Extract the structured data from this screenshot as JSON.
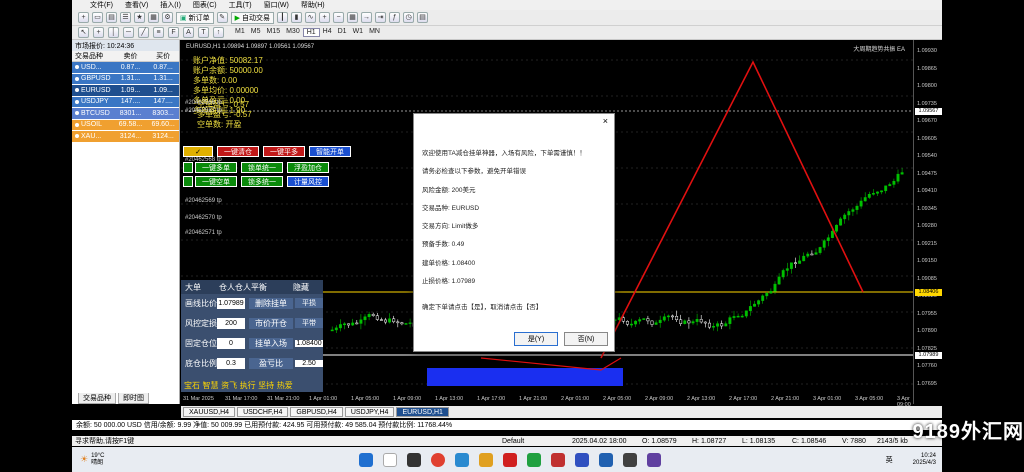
{
  "menu": [
    "文件(F)",
    "查看(V)",
    "插入(I)",
    "图表(C)",
    "工具(T)",
    "窗口(W)",
    "帮助(H)"
  ],
  "toolbar": {
    "new_order": "新订单",
    "auto_trade": "自动交易"
  },
  "timeframes": [
    "M1",
    "M5",
    "M15",
    "M30",
    "H1",
    "H4",
    "D1",
    "W1",
    "MN"
  ],
  "market_watch": {
    "title": "市场报价: 10:24:36",
    "headers": [
      "交易品种",
      "卖价",
      "买价"
    ],
    "rows": [
      {
        "symbol": "USD...",
        "bid": "0.87...",
        "ask": "0.87...",
        "color": "#3a76c4"
      },
      {
        "symbol": "GBPUSD",
        "bid": "1.31...",
        "ask": "1.31...",
        "color": "#3a76c4"
      },
      {
        "symbol": "EURUSD",
        "bid": "1.09...",
        "ask": "1.09...",
        "color": "#1f4f8f"
      },
      {
        "symbol": "USDJPY",
        "bid": "147....",
        "ask": "147....",
        "color": "#3a76c4"
      },
      {
        "symbol": "BTCUSD",
        "bid": "8301...",
        "ask": "8303...",
        "color": "#5a7fd0"
      },
      {
        "symbol": "USOIL",
        "bid": "69.58...",
        "ask": "69.60...",
        "color": "#f0a030"
      },
      {
        "symbol": "XAU...",
        "bid": "3124...",
        "ask": "3124...",
        "color": "#f0a030"
      }
    ],
    "tabs": [
      "交易品种",
      "即时图"
    ]
  },
  "chart": {
    "title": "EURUSD,H1  1.09894 1.09897 1.09561 1.09567",
    "right_title": "大周期趋势共振 EA",
    "account": [
      "账户净值: 50082.17",
      "账户余额: 50000.00",
      "多单数: 0.00",
      "多单均价: 0.00000",
      "多单盈亏: 0.00",
      "多单盈利: 1.90"
    ],
    "account_extra": [
      "空单盈亏: 0.57",
      "多单盈亏: -0.57",
      "空单数: 开盈"
    ],
    "order_ids": [
      "#20462566 tp",
      "#20462567 tp",
      "#20462568 tp",
      "#20462569 tp",
      "#20462570 tp",
      "#20462571 tp"
    ],
    "buttons_row1": [
      "一键清仓",
      "一键平多",
      "智能开单"
    ],
    "buttons_row2": [
      "一键多单",
      "锁单统一",
      "浮盈加仓"
    ],
    "buttons_row3": [
      "一键空单",
      "锁多统一",
      "计量风控"
    ],
    "panel": {
      "header_left": "大单",
      "header_mid": "仓人仓人平衡",
      "header_right": "隐藏",
      "rows": [
        {
          "label": "画线比价",
          "value": "1.07989",
          "btn": "删除挂单",
          "btn2": "平损"
        },
        {
          "label": "风控定损",
          "value": "200",
          "btn": "市价开仓",
          "btn2": "平带"
        },
        {
          "label": "固定仓位",
          "value": "0",
          "btn": "挂单入场",
          "btn2": "1.08400"
        },
        {
          "label": "底仓比例",
          "value": "0.3",
          "btn": "盈亏比",
          "btn2": "2.50"
        }
      ],
      "footer": "宝石 智慧 资飞 执行 坚持 热爱"
    }
  },
  "price_ticks": [
    "1.09930",
    "1.09865",
    "1.09800",
    "1.09735",
    "1.09670",
    "1.09605",
    "1.09540",
    "1.09475",
    "1.09410",
    "1.09345",
    "1.09280",
    "1.09215",
    "1.09150",
    "1.09085",
    "1.08020",
    "1.07955",
    "1.07890",
    "1.07825",
    "1.07760",
    "1.07695"
  ],
  "price_markers": {
    "current": "1.09567",
    "tp": "1.08406",
    "sl": "1.07989"
  },
  "time_ticks": [
    "31 Mar 2025",
    "31 Mar 17:00",
    "31 Mar 21:00",
    "1 Apr 01:00",
    "1 Apr 05:00",
    "1 Apr 09:00",
    "1 Apr 13:00",
    "1 Apr 17:00",
    "1 Apr 21:00",
    "2 Apr 01:00",
    "2 Apr 05:00",
    "2 Apr 09:00",
    "2 Apr 13:00",
    "2 Apr 17:00",
    "2 Apr 21:00",
    "3 Apr 01:00",
    "3 Apr 05:00",
    "3 Apr 09:00"
  ],
  "chart_tabs": [
    "XAUUSD,H4",
    "USDCHF,H4",
    "GBPUSD,H4",
    "USDJPY,H4",
    "EURUSD,H1"
  ],
  "account_bar": "余额: 50 000.00 USD  信用/余额: 9.99  净值: 50 009.99  已用预付款: 424.95  可用预付款: 49 585.04  预付款比例: 11768.44%",
  "status": {
    "help": "寻求帮助,请按F1键",
    "profile": "Default",
    "datetime": "2025.04.02 18:00",
    "open": "O: 1.08579",
    "high": "H: 1.08727",
    "low": "L: 1.08135",
    "close": "C: 1.08546",
    "volume": "V: 7880",
    "traffic": "2143/5 kb"
  },
  "dialog": {
    "lines": [
      "欢迎使用TA减仓挂单神器，入场有风险，下单需谨慎！！",
      "请务必检查以下参数，避免开单错误",
      "风险金额: 200美元",
      "交易品种: EURUSD",
      "交易方向: Limit做多",
      "预备手数: 0.49",
      "建单价格: 1.08400",
      "止损价格: 1.07989",
      "确定下单请点击【是】，取消请点击【否】"
    ],
    "yes": "是(Y)",
    "no": "否(N)"
  },
  "taskbar": {
    "weather": "19°C",
    "weather_sub": "晴朗",
    "time": "10:24",
    "date": "2025/4/3",
    "lang": "英"
  },
  "watermark": "9189外汇网",
  "colors": {
    "bull": "#00c000",
    "bear": "#ffffff",
    "trend": "#e01010",
    "tp_line": "#ffd700",
    "dialog_bg": "#ffffff"
  }
}
